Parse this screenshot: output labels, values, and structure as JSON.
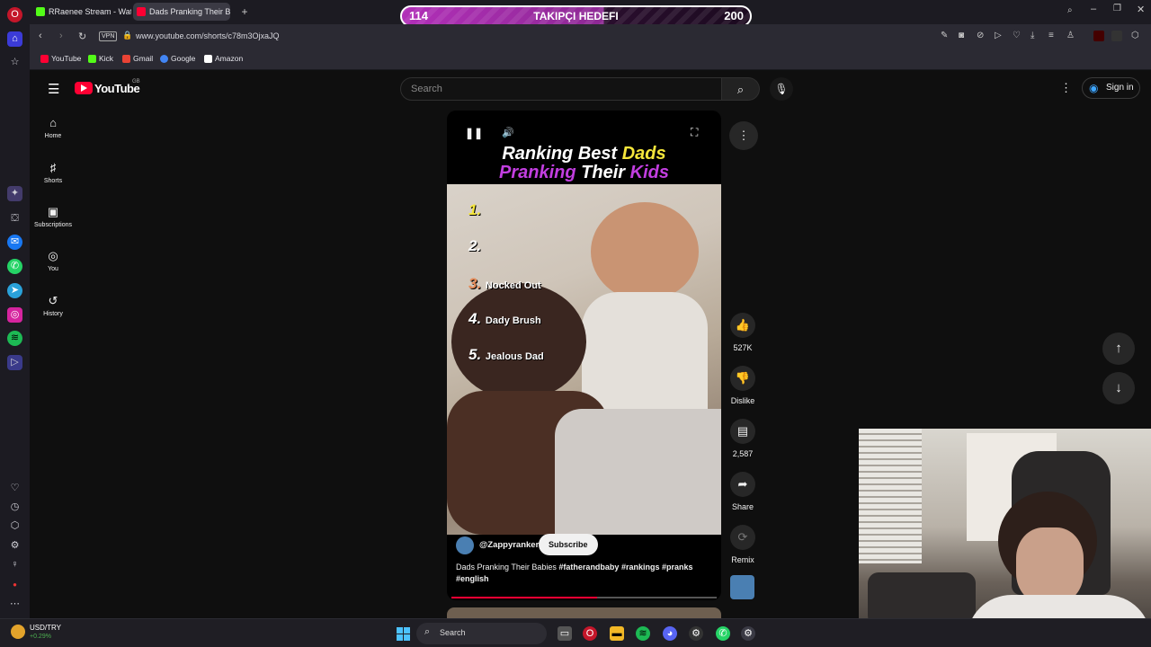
{
  "overlay": {
    "left_count": "114",
    "title": "TAKIPÇI HEDEFI",
    "right_count": "200"
  },
  "browser": {
    "tabs": [
      {
        "label": "RRaenee Stream - Watch"
      },
      {
        "label": "Dads Pranking Their B"
      }
    ],
    "new_tab_icon": "plus-icon",
    "url": "www.youtube.com/shorts/c78m3OjxaJQ",
    "vpn_badge": "VPN",
    "bookmarks": [
      {
        "label": "YouTube",
        "color": "#ff0033"
      },
      {
        "label": "Kick",
        "color": "#53fc18"
      },
      {
        "label": "Gmail",
        "color": "#ea4335"
      },
      {
        "label": "Google",
        "color": "#4285f4"
      },
      {
        "label": "Amazon",
        "color": "#ffffff"
      }
    ]
  },
  "youtube": {
    "logo_text": "YouTube",
    "region": "GB",
    "search_placeholder": "Search",
    "sign_in": "Sign in",
    "nav": [
      {
        "label": "Home",
        "icon": "home-icon"
      },
      {
        "label": "Shorts",
        "icon": "shorts-icon"
      },
      {
        "label": "Subscriptions",
        "icon": "subscriptions-icon"
      },
      {
        "label": "You",
        "icon": "user-icon"
      },
      {
        "label": "History",
        "icon": "history-icon"
      }
    ],
    "short": {
      "title_line1_a": "Ranking Best ",
      "title_line1_b": "Dads",
      "title_line2_a": "Pranking",
      "title_line2_b": " Their ",
      "title_line2_c": "Kids",
      "ranks": [
        {
          "num": "1.",
          "text": ""
        },
        {
          "num": "2.",
          "text": ""
        },
        {
          "num": "3.",
          "text": "Nocked Out"
        },
        {
          "num": "4.",
          "text": "Dady Brush"
        },
        {
          "num": "5.",
          "text": "Jealous Dad"
        }
      ],
      "channel": "@Zappyranker",
      "subscribe": "Subscribe",
      "caption": "Dads Pranking Their Babies",
      "hashtags": "#fatherandbaby #rankings #pranks",
      "hashtag2": "#english",
      "progress": 0.55
    },
    "actions": {
      "likes": "527K",
      "dislike": "Dislike",
      "comments": "2,587",
      "share": "Share",
      "remix": "Remix"
    }
  },
  "taskbar": {
    "ticker": "USD/TRY",
    "ticker_change": "+0.29%",
    "search": "Search"
  },
  "colors": {
    "accent_yellow": "#f5e63b",
    "accent_purple": "#c23ee0",
    "overlay_bg": "#a12ca8"
  }
}
